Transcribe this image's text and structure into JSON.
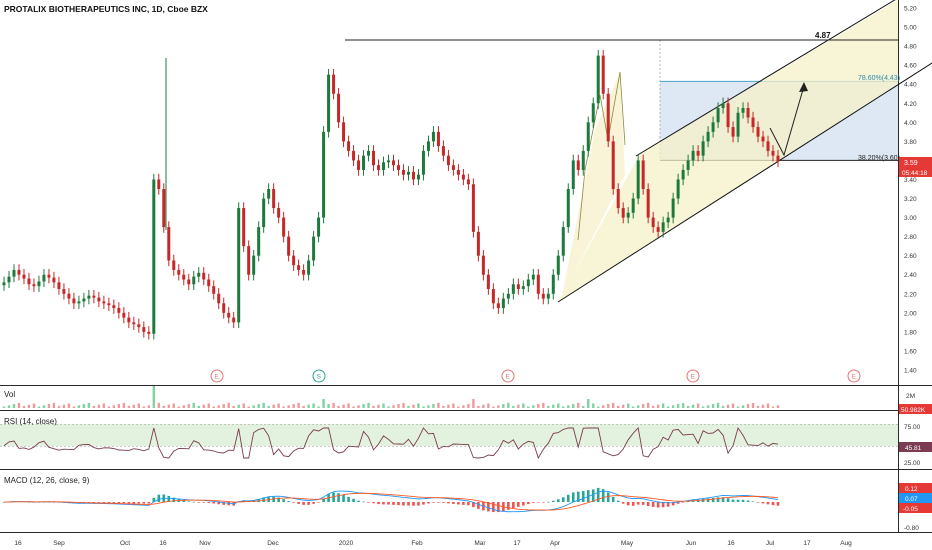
{
  "header": {
    "title": "PROTALIX BIOTHERAPEUTICS INC, 1D, Cboe BZX"
  },
  "price_axis": {
    "ticks": [
      "5.20",
      "5.00",
      "4.80",
      "4.60",
      "4.40",
      "4.20",
      "4.00",
      "3.80",
      "3.60",
      "3.40",
      "3.20",
      "3.00",
      "2.80",
      "2.60",
      "2.40",
      "2.20",
      "2.00",
      "1.80",
      "1.60",
      "1.40"
    ],
    "last_price": "3.59",
    "countdown": "05:44:18"
  },
  "annotations": {
    "resistance_label": "4.87",
    "fib_786_label": "78.60%(4.43)",
    "fib_382_label": "38.20%(3.60)"
  },
  "events": [
    "E",
    "S",
    "E",
    "E",
    "E"
  ],
  "volume_pane": {
    "label": "Vol",
    "axis_label": "2M",
    "value_badge": "50.982K"
  },
  "rsi_pane": {
    "label": "RSI (14, close)",
    "ticks": [
      "75.00",
      "25.00"
    ],
    "value_badge": "45.81"
  },
  "macd_pane": {
    "label": "MACD (12, 26, close, 9)",
    "value_badges": [
      "0.12",
      "0.07",
      "-0.05"
    ],
    "bottom_tick": "-0.80"
  },
  "time_axis": {
    "labels": [
      "16",
      "Sep",
      "Oct",
      "16",
      "Nov",
      "Dec",
      "2020",
      "Feb",
      "Mar",
      "17",
      "Apr",
      "May",
      "Jun",
      "16",
      "Jul",
      "17",
      "Aug"
    ]
  },
  "colors": {
    "up": "#26a69a",
    "up_dark": "#1e7a3c",
    "down": "#c62828",
    "rsi_line": "#7b3b52",
    "macd_line": "#2196f3",
    "signal_line": "#ff5722",
    "badge_red": "#e53935"
  },
  "chart_data": {
    "type": "candlestick",
    "title": "PROTALIX BIOTHERAPEUTICS INC, 1D, Cboe BZX",
    "ylim": [
      1.3,
      5.3
    ],
    "resistance": 4.87,
    "fib_levels": [
      {
        "ratio": "78.60%",
        "price": 4.43
      },
      {
        "ratio": "38.20%",
        "price": 3.6
      }
    ],
    "last_close": 3.59,
    "closes": [
      2.32,
      2.38,
      2.45,
      2.4,
      2.36,
      2.3,
      2.28,
      2.33,
      2.4,
      2.37,
      2.32,
      2.25,
      2.2,
      2.15,
      2.1,
      2.12,
      2.15,
      2.18,
      2.16,
      2.12,
      2.1,
      2.08,
      2.05,
      2.0,
      1.95,
      1.9,
      1.88,
      1.85,
      1.8,
      1.78,
      3.4,
      3.3,
      2.9,
      2.55,
      2.45,
      2.4,
      2.35,
      2.3,
      2.38,
      2.42,
      2.35,
      2.28,
      2.2,
      2.1,
      2.0,
      1.95,
      1.9,
      3.1,
      2.7,
      2.4,
      2.6,
      2.9,
      3.2,
      3.3,
      3.1,
      3.0,
      2.8,
      2.6,
      2.5,
      2.45,
      2.4,
      2.55,
      2.8,
      3.0,
      3.9,
      4.5,
      4.3,
      4.0,
      3.8,
      3.7,
      3.6,
      3.5,
      3.65,
      3.7,
      3.55,
      3.5,
      3.58,
      3.6,
      3.55,
      3.5,
      3.45,
      3.48,
      3.4,
      3.45,
      3.7,
      3.8,
      3.9,
      3.75,
      3.65,
      3.55,
      3.5,
      3.45,
      3.4,
      3.35,
      2.85,
      2.6,
      2.4,
      2.25,
      2.1,
      2.05,
      2.15,
      2.2,
      2.3,
      2.25,
      2.28,
      2.35,
      2.4,
      2.2,
      2.15,
      2.2,
      2.4,
      2.6,
      2.9,
      3.3,
      3.6,
      3.5,
      3.7,
      4.0,
      4.2,
      4.7,
      4.3,
      3.8,
      3.3,
      3.1,
      3.0,
      3.05,
      3.2,
      3.6,
      3.3,
      3.0,
      2.9,
      2.85,
      2.95,
      3.0,
      3.2,
      3.4,
      3.5,
      3.6,
      3.7,
      3.65,
      3.8,
      3.9,
      4.0,
      4.15,
      4.2,
      3.95,
      3.85,
      4.1,
      4.15,
      4.05,
      3.95,
      3.85,
      3.8,
      3.7,
      3.65,
      3.59
    ],
    "rsi_levels": [
      70,
      30
    ],
    "volume_spike_index": 30
  }
}
